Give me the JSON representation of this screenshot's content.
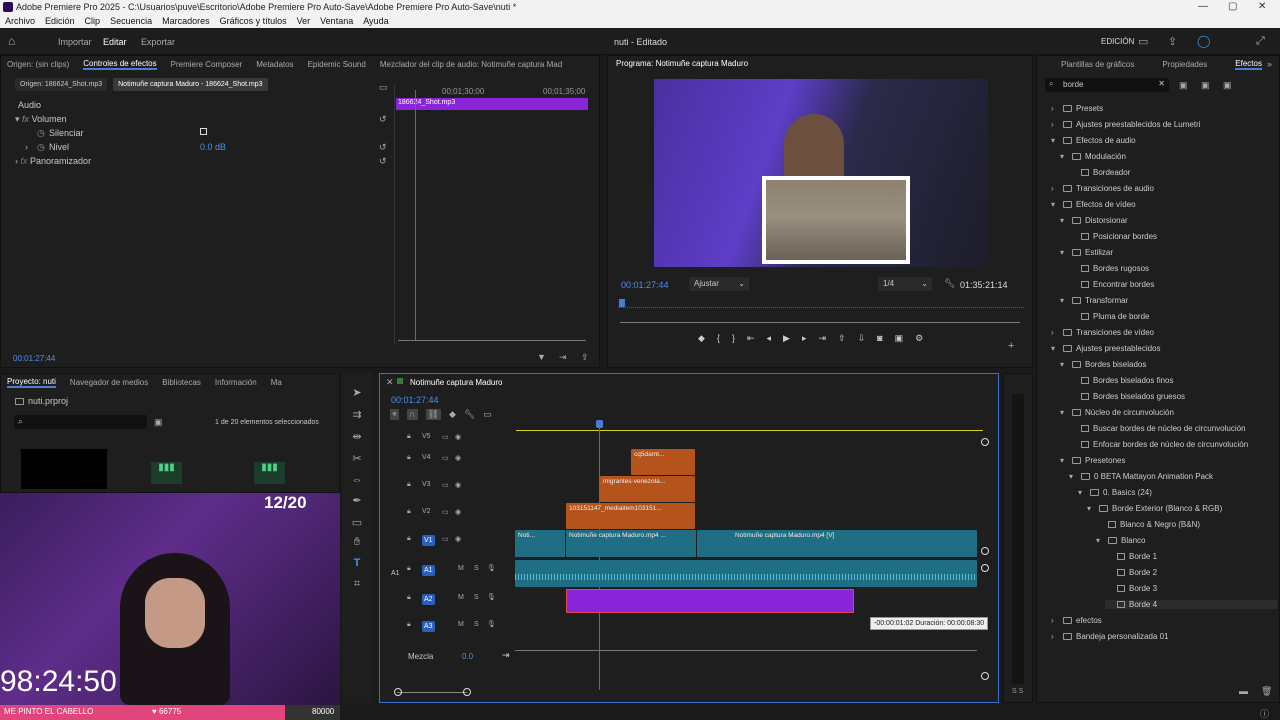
{
  "window": {
    "title": "Adobe Premiere Pro 2025 - C:\\Usuarios\\puve\\Escritorio\\Adobe Premiere Pro Auto-Save\\Adobe Premiere Pro Auto-Save\\nuti *"
  },
  "menu": [
    "Archivo",
    "Edición",
    "Clip",
    "Secuencia",
    "Marcadores",
    "Gráficos y títulos",
    "Ver",
    "Ventana",
    "Ayuda"
  ],
  "header": {
    "modes": [
      "Importar",
      "Editar",
      "Exportar"
    ],
    "project_title": "nuti - Editado",
    "workspace": "EDICIÓN"
  },
  "source_tabs": [
    "Origen: (sin clips)",
    "Controles de efectos",
    "Premiere Composer",
    "Metadatos",
    "Epidemic Sound",
    "Mezclador del clip de audio: Notimuñe captura Mad"
  ],
  "effect_controls": {
    "clip_tabs": [
      "Origen: 186624_Shot.mp3",
      "Notimuñe captura Maduro - 186624_Shot.mp3"
    ],
    "section": "Audio",
    "volume": "Volumen",
    "mute": "Silenciar",
    "level": "Nivel",
    "level_value": "0.0 dB",
    "panner": "Panoramizador",
    "ruler": [
      "00;01;30;00",
      "00;01;35;00"
    ],
    "clip_name": "186624_Shot.mp3",
    "timecode": "00:01:27:44"
  },
  "program": {
    "title": "Programa: Notimuñe captura Maduro",
    "timecode": "00:01:27:44",
    "fit": "Ajustar",
    "resolution": "1/4",
    "duration": "01:35:21:14"
  },
  "project": {
    "tabs": [
      "Proyecto: nuti",
      "Navegador de medios",
      "Bibliotecas",
      "Información",
      "Ma"
    ],
    "file": "nuti.prproj",
    "selection": "1 de 20 elementos seleccionados"
  },
  "timeline": {
    "title": "Notimuñe captura Maduro",
    "timecode": "00:01:27:44",
    "tracks": [
      "V5",
      "V4",
      "V3",
      "V2",
      "V1",
      "A1",
      "A2",
      "A3"
    ],
    "clips": {
      "v4": "cq5damt...",
      "v3": "migrantes-venezola...",
      "v2": "103151147_mediaitem103151...",
      "v1a": "Noti...",
      "v1b": "Notimuñe captura Maduro.mp4 ...",
      "v1c": "Notimuñe captura Maduro.mp4 [V]"
    },
    "mix": "Mezcla",
    "mix_value": "0.0",
    "tooltip": "-00:00:01:02 Duración: 00:00:08:30",
    "a1_label": "A1"
  },
  "effects_panel": {
    "tabs": [
      "Plantillas de gráficos",
      "Propiedades",
      "Efectos"
    ],
    "search": "borde",
    "tree": [
      {
        "level": 0,
        "type": "folder",
        "open": false,
        "label": "Presets"
      },
      {
        "level": 0,
        "type": "folder",
        "open": false,
        "label": "Ajustes preestablecidos de Lumetri"
      },
      {
        "level": 0,
        "type": "folder",
        "open": true,
        "label": "Efectos de audio"
      },
      {
        "level": 1,
        "type": "folder",
        "open": true,
        "label": "Modulación"
      },
      {
        "level": 2,
        "type": "fx",
        "label": "Bordeador"
      },
      {
        "level": 0,
        "type": "folder",
        "open": false,
        "label": "Transiciones de audio"
      },
      {
        "level": 0,
        "type": "folder",
        "open": true,
        "label": "Efectos de vídeo"
      },
      {
        "level": 1,
        "type": "folder",
        "open": true,
        "label": "Distorsionar"
      },
      {
        "level": 2,
        "type": "fx",
        "label": "Posicionar bordes"
      },
      {
        "level": 1,
        "type": "folder",
        "open": true,
        "label": "Estilizar"
      },
      {
        "level": 2,
        "type": "fx",
        "label": "Bordes rugosos"
      },
      {
        "level": 2,
        "type": "fx",
        "label": "Encontrar bordes"
      },
      {
        "level": 1,
        "type": "folder",
        "open": true,
        "label": "Transformar"
      },
      {
        "level": 2,
        "type": "fx",
        "label": "Pluma de borde"
      },
      {
        "level": 0,
        "type": "folder",
        "open": false,
        "label": "Transiciones de vídeo"
      },
      {
        "level": 0,
        "type": "folder",
        "open": true,
        "label": "Ajustes preestablecidos"
      },
      {
        "level": 1,
        "type": "folder",
        "open": true,
        "label": "Bordes biselados"
      },
      {
        "level": 2,
        "type": "fx",
        "label": "Bordes biselados finos"
      },
      {
        "level": 2,
        "type": "fx",
        "label": "Bordes biselados gruesos"
      },
      {
        "level": 1,
        "type": "folder",
        "open": true,
        "label": "Núcleo de circunvolución"
      },
      {
        "level": 2,
        "type": "fx",
        "label": "Buscar bordes de núcleo de circunvolución"
      },
      {
        "level": 2,
        "type": "fx",
        "label": "Enfocar bordes de núcleo de circunvolución"
      },
      {
        "level": 1,
        "type": "folder",
        "open": true,
        "label": "Presetones"
      },
      {
        "level": 2,
        "type": "folder",
        "open": true,
        "label": "0 BETA Mattayon Animation Pack"
      },
      {
        "level": 3,
        "type": "folder",
        "open": true,
        "label": "0. Basics (24)"
      },
      {
        "level": 4,
        "type": "folder",
        "open": true,
        "label": "Borde Exterior (Blanco & RGB)"
      },
      {
        "level": 5,
        "type": "fx",
        "label": "Blanco & Negro (B&N)"
      },
      {
        "level": 5,
        "type": "folder",
        "open": true,
        "label": "Blanco"
      },
      {
        "level": 6,
        "type": "fx",
        "label": "Borde 1"
      },
      {
        "level": 6,
        "type": "fx",
        "label": "Borde 2"
      },
      {
        "level": 6,
        "type": "fx",
        "label": "Borde 3"
      },
      {
        "level": 6,
        "type": "fx",
        "label": "Borde 4"
      },
      {
        "level": 0,
        "type": "folder",
        "open": false,
        "label": "efectos"
      },
      {
        "level": 0,
        "type": "folder",
        "open": false,
        "label": "Bandeja personalizada 01"
      }
    ]
  },
  "stream": {
    "counter": "12/20",
    "clock": "98:24:50",
    "goal_label": "ME PINTO EL CABELLO",
    "goal_current": "66775",
    "goal_target": "80000"
  },
  "colors": {
    "accent": "#4a7bd8",
    "purple_clip": "#8a24d8",
    "teal_clip": "#1f6e83",
    "orange_clip": "#b5531c",
    "stream_bar": "#e0457b"
  }
}
